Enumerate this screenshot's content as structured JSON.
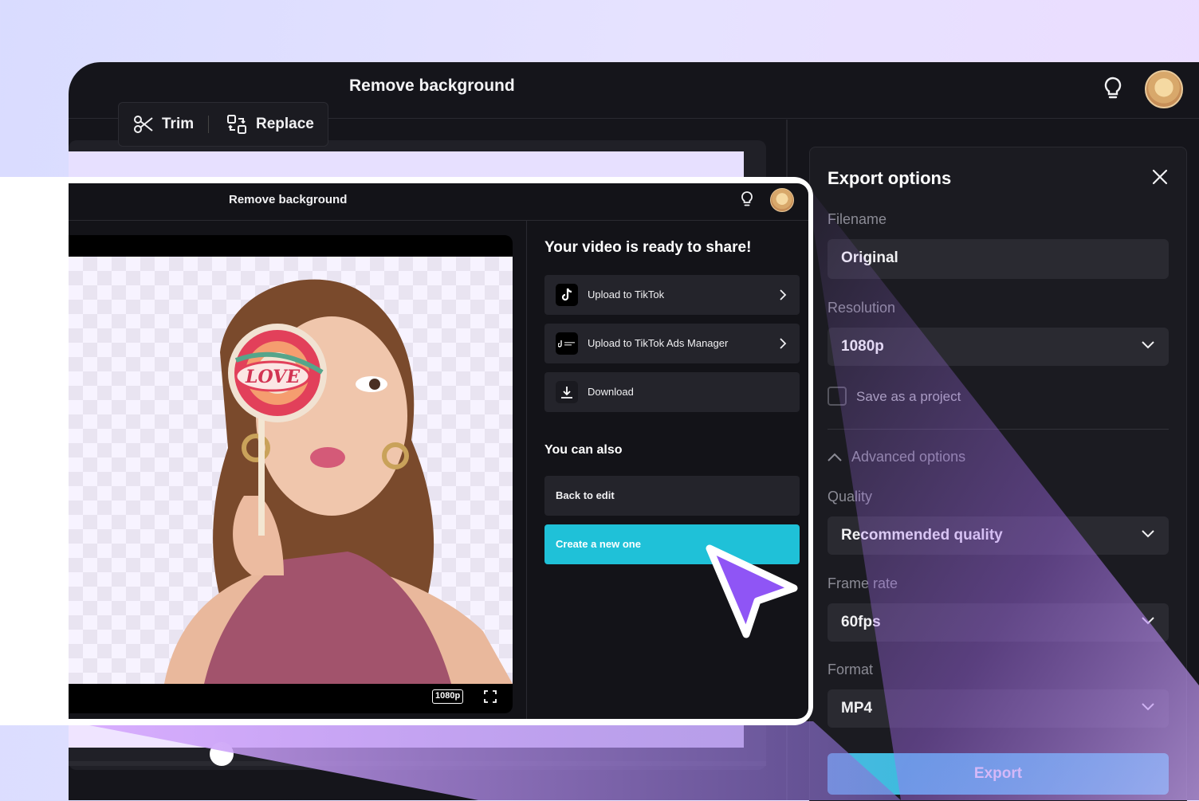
{
  "app": {
    "title": "Remove background",
    "toolbar": {
      "trim_label": "Trim",
      "replace_label": "Replace"
    },
    "icons": [
      "lightbulb-icon",
      "avatar",
      "scissors-icon",
      "replace-icon"
    ]
  },
  "export_panel": {
    "title": "Export options",
    "filename": {
      "label": "Filename",
      "value": "Original"
    },
    "resolution": {
      "label": "Resolution",
      "value": "1080p"
    },
    "save_project": {
      "label": "Save as a project",
      "checked": false
    },
    "advanced": {
      "label": "Advanced options",
      "expanded": true
    },
    "quality": {
      "label": "Quality",
      "value": "Recommended quality"
    },
    "frame_rate": {
      "label": "Frame rate",
      "value": "60fps"
    },
    "format": {
      "label": "Format",
      "value": "MP4"
    },
    "export_label": "Export",
    "accent_color": "#21c6d8"
  },
  "share_dialog": {
    "title": "Remove background",
    "heading": "Your video is ready to share!",
    "actions": [
      {
        "label": "Upload to TikTok",
        "icon": "tiktok-icon"
      },
      {
        "label": "Upload to TikTok Ads Manager",
        "icon": "tiktok-ads-icon"
      },
      {
        "label": "Download",
        "icon": "download-icon"
      }
    ],
    "also_heading": "You can also",
    "back_label": "Back to edit",
    "new_label": "Create a new one",
    "video": {
      "resolution_badge": "1080p"
    }
  }
}
